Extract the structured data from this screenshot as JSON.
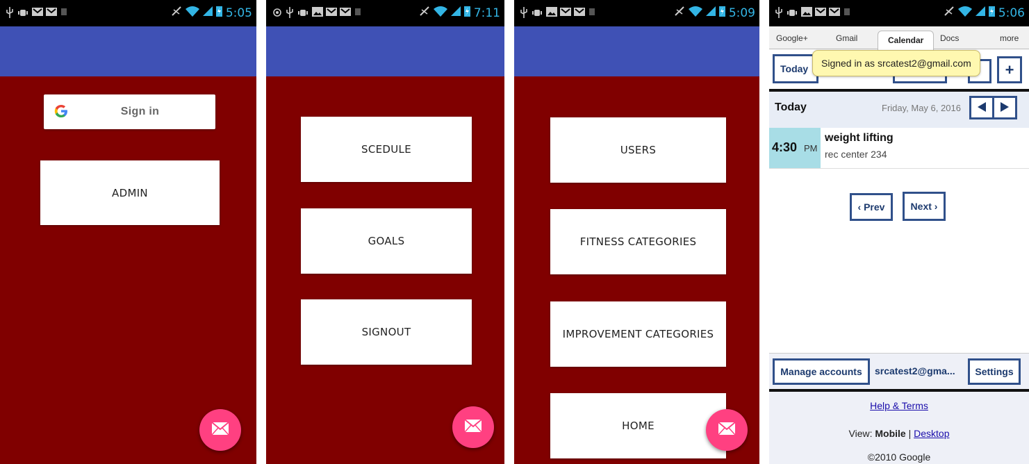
{
  "colors": {
    "app_bar": "#3f51b5",
    "content_bg": "#800000",
    "fab": "#ff4081",
    "clock": "#33b5e5",
    "calendar_btn_border": "#30508a",
    "event_time_bg": "#a8dde6"
  },
  "screen1": {
    "time": "5:05",
    "signin_label": "Sign in",
    "admin_label": "ADMIN",
    "fab_icon": "mail-icon"
  },
  "screen2": {
    "time": "7:11",
    "buttons": [
      "SCEDULE",
      "GOALS",
      "SIGNOUT"
    ],
    "fab_icon": "mail-icon"
  },
  "screen3": {
    "time": "5:09",
    "buttons": [
      "USERS",
      "FITNESS CATEGORIES",
      "IMPROVEMENT CATEGORIES",
      "HOME"
    ],
    "fab_icon": "mail-icon"
  },
  "screen4": {
    "time": "5:06",
    "tabs": [
      "Google+",
      "Gmail",
      "Calendar",
      "Docs",
      "more"
    ],
    "active_tab": "Calendar",
    "today_button": "Today",
    "plus_button": "+",
    "tooltip": "Signed in as srcatest2@gmail.com",
    "day_label": "Today",
    "date": "Friday, May 6, 2016",
    "event": {
      "time": "4:30",
      "ampm": "PM",
      "title": "weight lifting",
      "location": "rec center 234"
    },
    "prev_label": "‹ Prev",
    "next_label": "Next ›",
    "manage_accounts": "Manage accounts",
    "account_email": "srcatest2@gma...",
    "settings": "Settings",
    "help_terms": "Help & Terms",
    "view_prefix": "View:",
    "view_mobile": "Mobile",
    "view_sep": "|",
    "view_desktop": "Desktop",
    "copyright": "©2010 Google"
  }
}
